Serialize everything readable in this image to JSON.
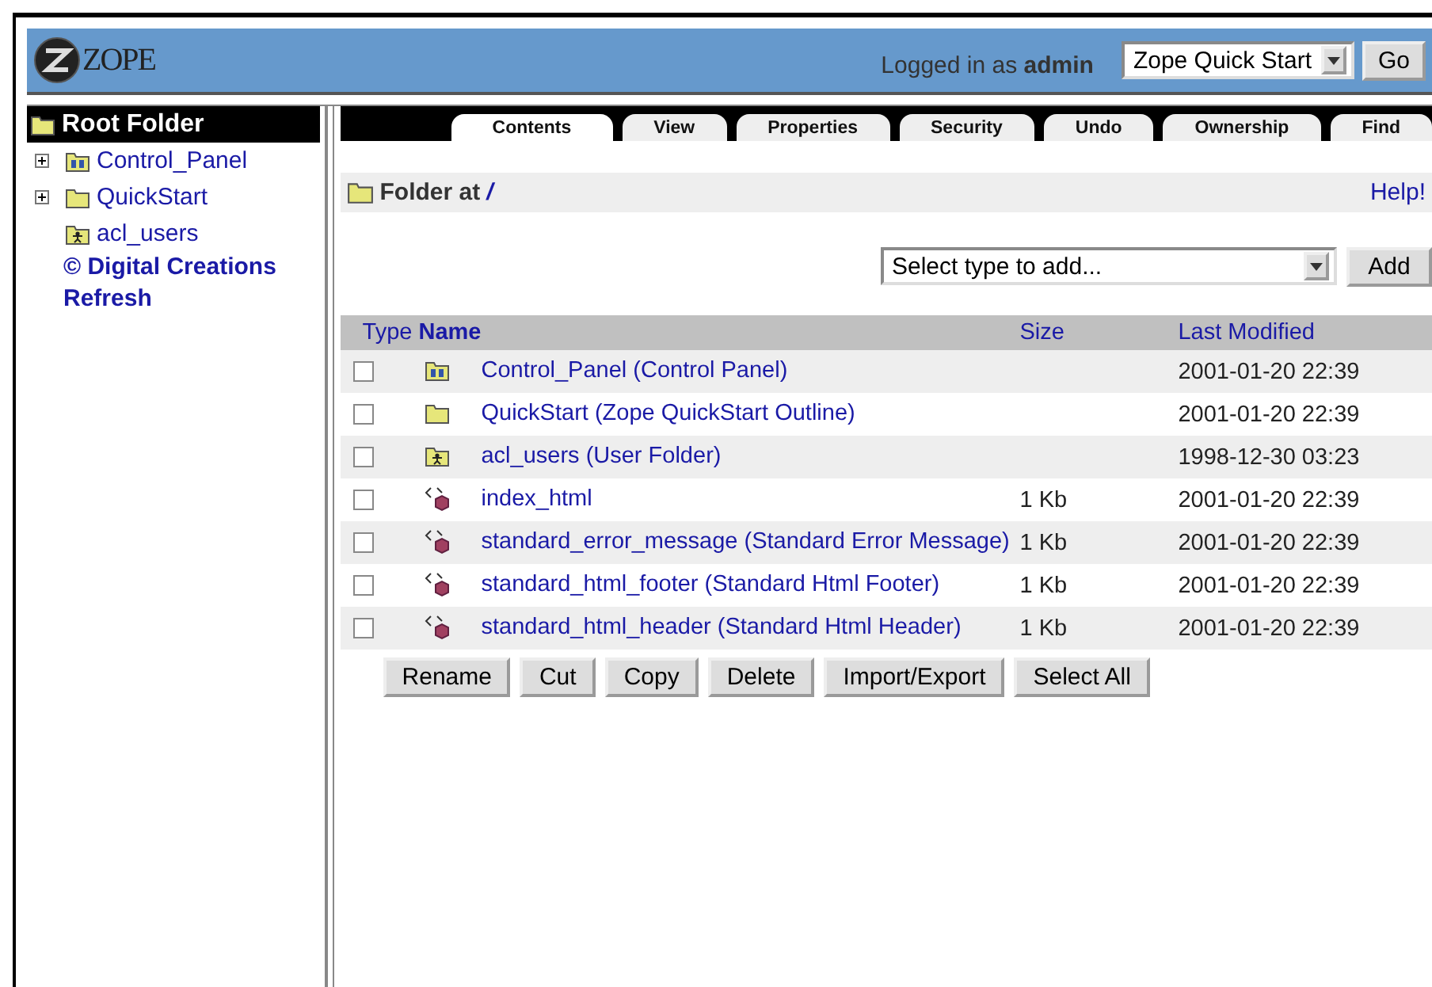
{
  "header": {
    "logo": "ZOPE",
    "login_prefix": "Logged in as",
    "user": "admin",
    "view_select": "Zope Quick Start",
    "go_button": "Go"
  },
  "tree": {
    "root": "Root Folder",
    "items": [
      {
        "label": "Control_Panel",
        "kind": "control_panel",
        "expandable": true
      },
      {
        "label": "QuickStart",
        "kind": "folder",
        "expandable": true
      },
      {
        "label": "acl_users",
        "kind": "user_folder",
        "expandable": false
      }
    ],
    "copyright": "© Digital Creations",
    "refresh": "Refresh"
  },
  "tabs": [
    {
      "label": "Contents",
      "selected": true
    },
    {
      "label": "View",
      "selected": false
    },
    {
      "label": "Properties",
      "selected": false
    },
    {
      "label": "Security",
      "selected": false
    },
    {
      "label": "Undo",
      "selected": false
    },
    {
      "label": "Ownership",
      "selected": false
    },
    {
      "label": "Find",
      "selected": false
    }
  ],
  "location": {
    "prefix": "Folder at",
    "path": "/",
    "help": "Help!"
  },
  "add": {
    "placeholder": "Select type to add...",
    "button": "Add"
  },
  "table": {
    "columns": [
      "Type",
      "Name",
      "Size",
      "Last Modified"
    ],
    "rows": [
      {
        "kind": "control_panel",
        "name": "Control_Panel (Control Panel)",
        "size": "",
        "modified": "2001-01-20 22:39",
        "checked": false
      },
      {
        "kind": "folder",
        "name": "QuickStart (Zope QuickStart Outline)",
        "size": "",
        "modified": "2001-01-20 22:39",
        "checked": false
      },
      {
        "kind": "user_folder",
        "name": "acl_users (User Folder)",
        "size": "",
        "modified": "1998-12-30 03:23",
        "checked": false
      },
      {
        "kind": "dtml",
        "name": "index_html",
        "size": "1 Kb",
        "modified": "2001-01-20 22:39",
        "checked": false
      },
      {
        "kind": "dtml",
        "name": "standard_error_message (Standard Error Message)",
        "size": "1 Kb",
        "modified": "2001-01-20 22:39",
        "checked": false
      },
      {
        "kind": "dtml",
        "name": "standard_html_footer (Standard Html Footer)",
        "size": "1 Kb",
        "modified": "2001-01-20 22:39",
        "checked": false
      },
      {
        "kind": "dtml",
        "name": "standard_html_header (Standard Html Header)",
        "size": "1 Kb",
        "modified": "2001-01-20 22:39",
        "checked": false
      }
    ]
  },
  "actions": [
    "Rename",
    "Cut",
    "Copy",
    "Delete",
    "Import/Export",
    "Select All"
  ]
}
